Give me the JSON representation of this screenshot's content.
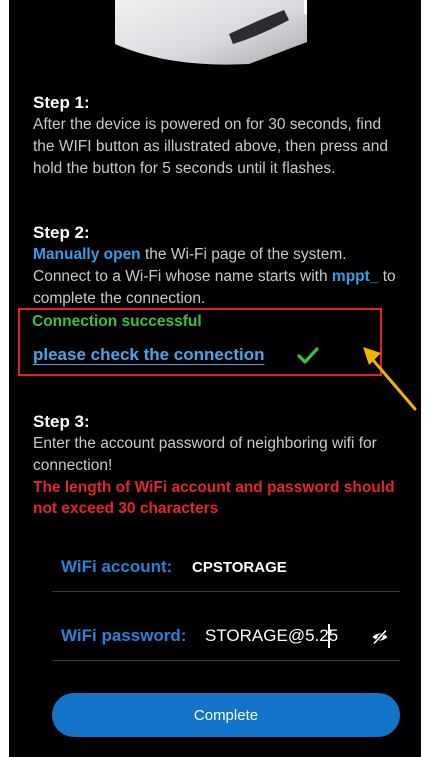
{
  "step1": {
    "title": "Step 1:",
    "text": "After the device is powered on for 30 seconds, find the WIFI button as illustrated above, then press and hold the button for 5 seconds until it flashes."
  },
  "step2": {
    "title": "Step 2:",
    "manual_link": "Manually open",
    "text_part1": " the Wi-Fi page of the system. Connect to a Wi-Fi whose name starts with ",
    "prefix": "mppt_",
    "text_part2": " to complete the connection."
  },
  "connection": {
    "status": "Connection successful",
    "check_link": "please check the connection",
    "status_color": "#3fbf3f"
  },
  "step3": {
    "title": "Step 3:",
    "text": "Enter the account password of neighboring wifi for connection!",
    "warning": "The length of WiFi account and password should not exceed 30 characters"
  },
  "form": {
    "account_label": "WiFi account:",
    "account_value": "CPSTORAGE",
    "password_label": "WiFi password:",
    "password_value": "STORAGE@5.25"
  },
  "actions": {
    "complete_label": "Complete"
  },
  "colors": {
    "accent_blue": "#1273c8",
    "warning_red": "#e3262b",
    "annotation_box": "#e0202a",
    "annotation_arrow": "#f5b301"
  },
  "icons": {
    "check": "check-icon",
    "eye_hidden": "eye-off-icon"
  }
}
